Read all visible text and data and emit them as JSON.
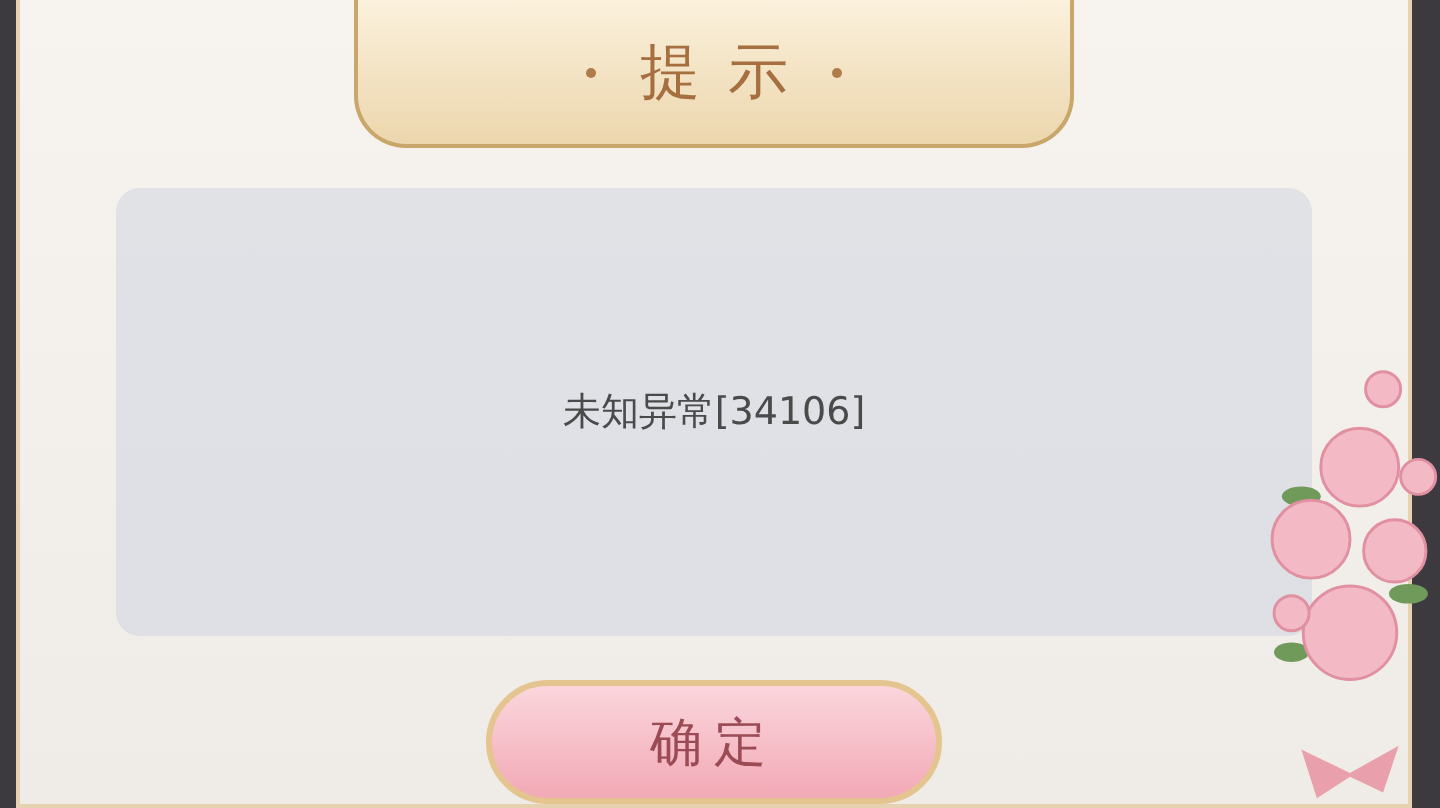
{
  "dialog": {
    "title": "提示",
    "message": "未知异常[34106]",
    "buttons": [
      "确定"
    ]
  }
}
